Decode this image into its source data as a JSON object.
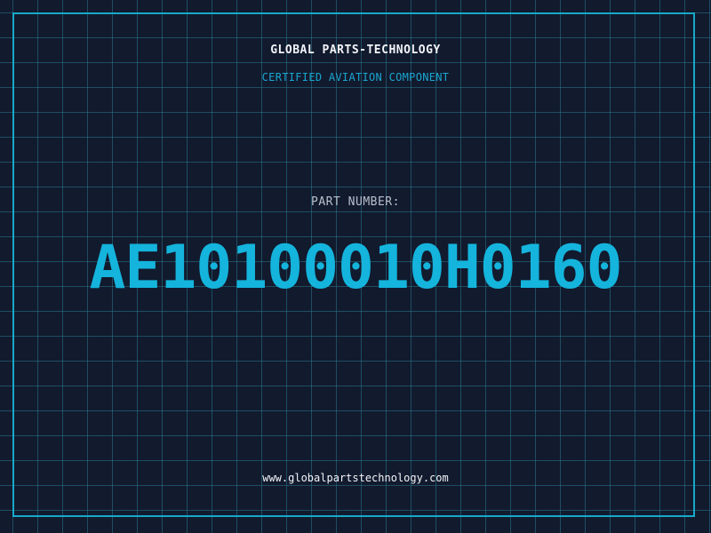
{
  "header": {
    "company": "GLOBAL PARTS-TECHNOLOGY",
    "tagline": "CERTIFIED AVIATION COMPONENT"
  },
  "part": {
    "label": "PART NUMBER:",
    "number": "AE10100010H0160"
  },
  "footer": {
    "website": "www.globalpartstechnology.com"
  },
  "colors": {
    "background": "#121a2e",
    "grid": "#28788c",
    "frame": "#17a9c9",
    "accent": "#14b4dc",
    "text": "#f2f4f8",
    "muted": "#b8c0cc"
  }
}
